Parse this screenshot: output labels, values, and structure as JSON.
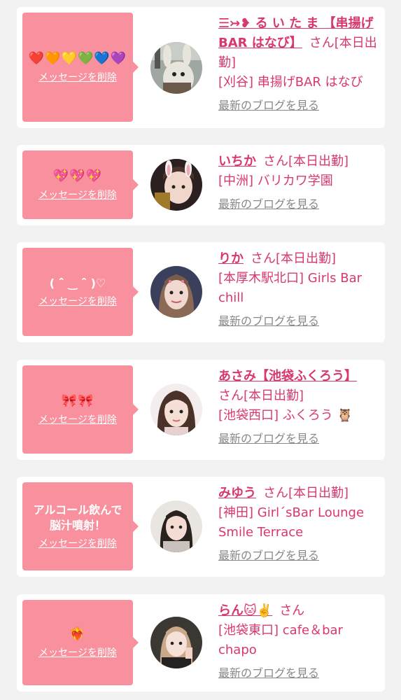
{
  "common": {
    "delete_label": "メッセージを削除",
    "blog_label": "最新のブログを見る"
  },
  "cards": [
    {
      "message": "❤️🧡💛💚💙💜",
      "name": "☰↣❥ る い た ま 【串揚げBAR はなび】",
      "san": "さん[本日出勤]",
      "shop": "[刈谷] 串揚げBAR はなび"
    },
    {
      "message": "💖💖💖",
      "name": "いちか",
      "san": "さん[本日出勤]",
      "shop": "[中洲] バリカワ学園"
    },
    {
      "message": "( ˆ̑ ‿ ˆ̑ )♡",
      "name": "りか",
      "san": "さん[本日出勤]",
      "shop": "[本厚木駅北口] Girls Bar chill"
    },
    {
      "message": "🎀🎀",
      "name": "あさみ【池袋ふくろう】",
      "san": "さん[本日出勤]",
      "shop": "[池袋西口] ふくろう 🦉"
    },
    {
      "message": "アルコール飲んで\n脳汁噴射！",
      "name": "みゆう",
      "san": "さん[本日出勤]",
      "shop": "[神田] Girl´sBar Lounge Smile Terrace"
    },
    {
      "message": "❤️‍🔥",
      "name": "らん🐱✌️",
      "san": "さん",
      "shop": "[池袋東口] cafe＆bar chapo"
    }
  ]
}
